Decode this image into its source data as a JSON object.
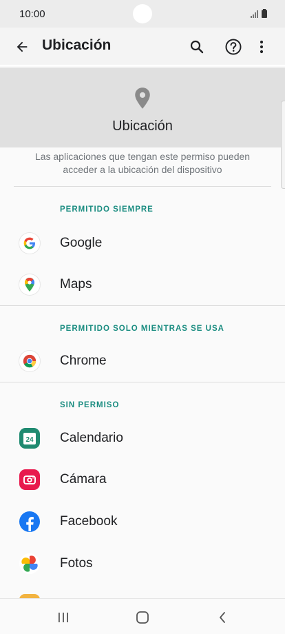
{
  "status_bar": {
    "time": "10:00"
  },
  "app_bar": {
    "title": "Ubicación"
  },
  "hero": {
    "title": "Ubicación"
  },
  "description": "Las aplicaciones que tengan este permiso pueden acceder a la ubicación del dispositivo",
  "sections": {
    "always": {
      "label": "PERMITIDO SIEMPRE",
      "apps": [
        "Google",
        "Maps"
      ]
    },
    "while_in_use": {
      "label": "PERMITIDO SOLO MIENTRAS SE USA",
      "apps": [
        "Chrome"
      ]
    },
    "denied": {
      "label": "SIN PERMISO",
      "apps": [
        "Calendario",
        "Cámara",
        "Facebook",
        "Fotos"
      ]
    }
  },
  "icons": {
    "calendar_day": "24"
  },
  "colors": {
    "accent": "#1a8c80",
    "hero_bg": "#e0e0e0",
    "calendar": "#1f8a70",
    "camera": "#e8194d",
    "facebook": "#1877f2"
  }
}
